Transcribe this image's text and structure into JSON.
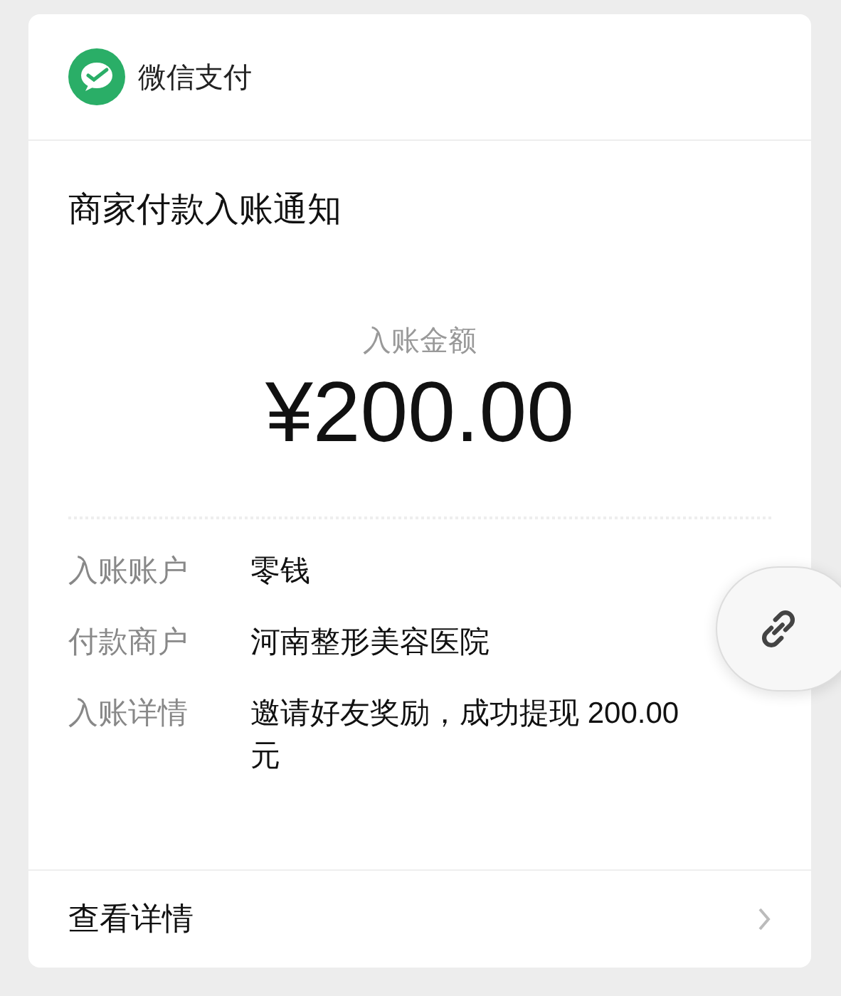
{
  "app": {
    "name": "微信支付"
  },
  "notice": {
    "title": "商家付款入账通知",
    "amount_label": "入账金额",
    "amount": "¥200.00"
  },
  "details": [
    {
      "label": "入账账户",
      "value": "零钱"
    },
    {
      "label": "付款商户",
      "value": "河南整形美容医院"
    },
    {
      "label": "入账详情",
      "value": "邀请好友奖励，成功提现 200.00 元"
    }
  ],
  "footer": {
    "link": "查看详情"
  }
}
